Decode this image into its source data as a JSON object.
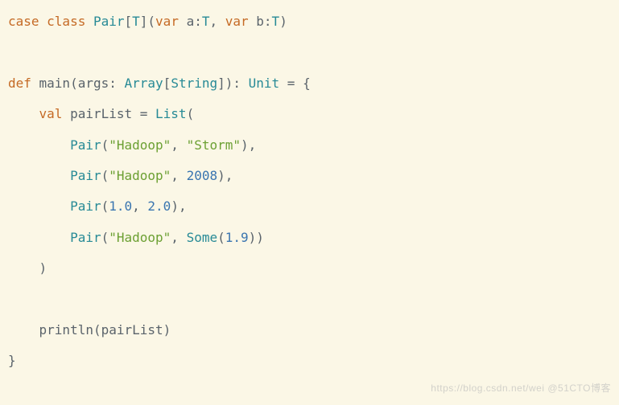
{
  "code": {
    "l1": {
      "t1": "case class ",
      "t2": "Pair",
      "t3": "[",
      "t4": "T",
      "t5": "](",
      "t6": "var ",
      "t7": "a:",
      "t8": "T",
      "t9": ", ",
      "t10": "var ",
      "t11": "b:",
      "t12": "T",
      "t13": ")"
    },
    "l2": "",
    "l3": {
      "t1": "def ",
      "t2": "main(args: ",
      "t3": "Array",
      "t4": "[",
      "t5": "String",
      "t6": "]): ",
      "t7": "Unit",
      "t8": " = {"
    },
    "l4": {
      "t1": "    ",
      "t2": "val ",
      "t3": "pairList = ",
      "t4": "List",
      "t5": "("
    },
    "l5": {
      "t1": "        ",
      "t2": "Pair",
      "t3": "(",
      "t4": "\"Hadoop\"",
      "t5": ", ",
      "t6": "\"Storm\"",
      "t7": "),"
    },
    "l6": {
      "t1": "        ",
      "t2": "Pair",
      "t3": "(",
      "t4": "\"Hadoop\"",
      "t5": ", ",
      "t6": "2008",
      "t7": "),"
    },
    "l7": {
      "t1": "        ",
      "t2": "Pair",
      "t3": "(",
      "t4": "1.0",
      "t5": ", ",
      "t6": "2.0",
      "t7": "),"
    },
    "l8": {
      "t1": "        ",
      "t2": "Pair",
      "t3": "(",
      "t4": "\"Hadoop\"",
      "t5": ", ",
      "t6": "Some",
      "t7": "(",
      "t8": "1.9",
      "t9": "))"
    },
    "l9": {
      "t1": "    )"
    },
    "l10": "",
    "l11": {
      "t1": "    println(pairList)"
    },
    "l12": {
      "t1": "}"
    }
  },
  "watermark": "https://blog.csdn.net/wei @51CTO博客"
}
